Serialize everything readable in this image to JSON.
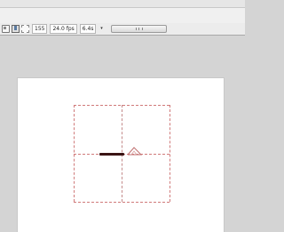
{
  "timeline": {
    "current_frame": "155",
    "frame_rate": "24.0 fps",
    "elapsed_time": "6.4s",
    "dropdown_arrow": "▾"
  },
  "icons": {
    "onion_skin": "onion-skin-icon",
    "onion_skin_outlines": "onion-skin-outlines-icon",
    "edit_multiple_frames": "edit-multiple-frames-icon",
    "scrollbar_grip": "scrollbar-grip-icon"
  },
  "colors": {
    "guide_red": "#d07a7a",
    "stage_white": "#ffffff",
    "workspace_grey": "#d4d4d4",
    "dark_stroke": "#3a1414",
    "shape_outline": "#c07070"
  }
}
